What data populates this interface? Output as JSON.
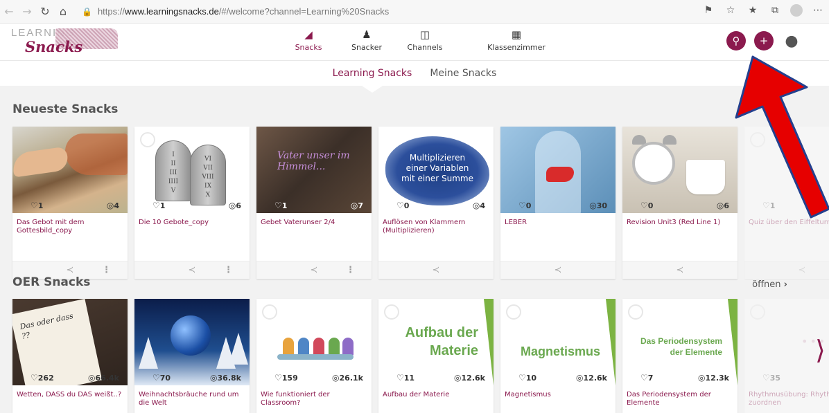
{
  "browser": {
    "url_prefix": "https://",
    "url_domain": "www.learningsnacks.de",
    "url_rest": "/#/welcome?channel=Learning%20Snacks"
  },
  "header": {
    "logo_top": "LEARNING",
    "logo_script": "Snacks",
    "nav": [
      {
        "label": "Snacks",
        "icon": "snack-icon",
        "active": true
      },
      {
        "label": "Snacker",
        "icon": "person-icon",
        "active": false
      },
      {
        "label": "Channels",
        "icon": "channel-icon",
        "active": false
      },
      {
        "label": "Klassenzimmer",
        "icon": "classroom-icon",
        "active": false
      }
    ]
  },
  "subnav": {
    "tabs": [
      {
        "label": "Learning Snacks",
        "active": true
      },
      {
        "label": "Meine Snacks",
        "active": false
      }
    ]
  },
  "sections": {
    "newest": {
      "title": "Neueste Snacks",
      "cards": [
        {
          "title": "Das Gebot mit dem Gottesbild_copy",
          "likes": "1",
          "views": "4"
        },
        {
          "title": "Die 10 Gebote_copy",
          "likes": "1",
          "views": "6"
        },
        {
          "title": "Gebet Vaterunser 2/4",
          "likes": "1",
          "views": "7",
          "thumb_text": "Vater unser im Himmel..."
        },
        {
          "title": "Auflösen von Klammern (Multiplizieren)",
          "likes": "0",
          "views": "4",
          "thumb_text": "Multiplizieren einer Variablen mit einer Summe"
        },
        {
          "title": "LEBER",
          "likes": "0",
          "views": "30"
        },
        {
          "title": "Revision Unit3 (Red Line 1)",
          "likes": "0",
          "views": "6"
        },
        {
          "title": "Quiz über den Eiffelturm",
          "likes": "1",
          "views": ""
        }
      ]
    },
    "oer": {
      "title": "OER Snacks",
      "open_label": "öffnen",
      "cards": [
        {
          "title": "Wetten, DASS du DAS weißt..?",
          "likes": "262",
          "views": "66.4k",
          "thumb_text": "Das oder dass ??"
        },
        {
          "title": "Weihnachtsbräuche rund um die Welt",
          "likes": "70",
          "views": "36.8k"
        },
        {
          "title": "Wie funktioniert der Classroom?",
          "likes": "159",
          "views": "26.1k"
        },
        {
          "title": "Aufbau der Materie",
          "likes": "11",
          "views": "12.6k",
          "thumb_line1": "Aufbau der",
          "thumb_line2": "Materie"
        },
        {
          "title": "Magnetismus",
          "likes": "10",
          "views": "12.6k",
          "thumb_line1": "Magnetismus"
        },
        {
          "title": "Das Periodensystem der Elemente",
          "likes": "7",
          "views": "12.3k",
          "thumb_line1": "Das Periodensystem",
          "thumb_line2": "der Elemente"
        },
        {
          "title": "Rhythmusübung: Rhythmen zuordnen",
          "likes": "35",
          "views": ""
        }
      ]
    }
  },
  "colors": {
    "brand": "#8b1a4e",
    "annotation_arrow": "#e60000"
  }
}
